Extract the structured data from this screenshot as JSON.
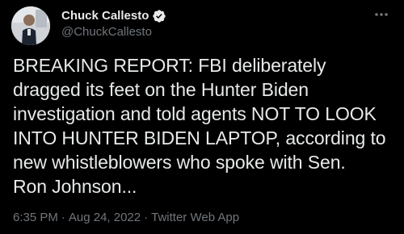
{
  "author": {
    "display_name": "Chuck Callesto",
    "handle": "@ChuckCallesto",
    "verified": true
  },
  "tweet": {
    "text": "BREAKING REPORT: FBI deliberately\ndragged its feet on the Hunter Biden\ninvestigation and told agents NOT TO LOOK\nINTO HUNTER BIDEN LAPTOP, according to\nnew whistleblowers who spoke with Sen.\nRon Johnson...",
    "time": "6:35 PM",
    "separator": "·",
    "date": "Aug 24, 2022",
    "source": "Twitter Web App"
  },
  "icons": {
    "verified": "verified-badge-icon",
    "more": "more-options-icon"
  },
  "colors": {
    "background": "#000000",
    "primary_text": "#e7e9ea",
    "secondary_text": "#71767b",
    "verified_blue": "#1d9bf0"
  }
}
